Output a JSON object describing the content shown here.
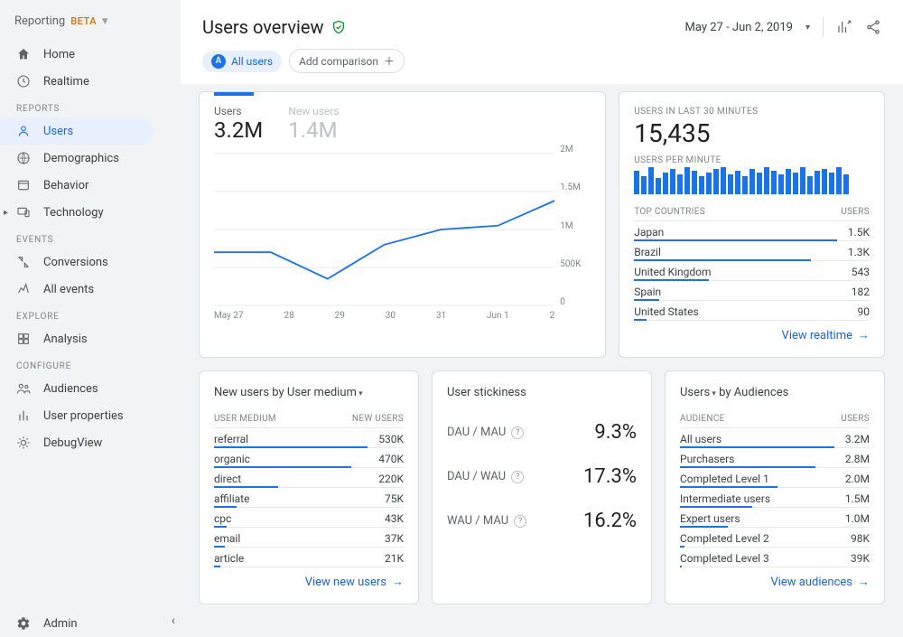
{
  "header": {
    "reporting_label": "Reporting",
    "beta_label": "BETA",
    "title": "Users overview",
    "date_range": "May 27 - Jun 2, 2019",
    "all_users_pill": "All users",
    "all_users_letter": "A",
    "add_comparison": "Add comparison"
  },
  "sidebar": {
    "top": [
      {
        "label": "Home"
      },
      {
        "label": "Realtime"
      }
    ],
    "reports_label": "REPORTS",
    "reports": [
      {
        "label": "Users",
        "active": true
      },
      {
        "label": "Demographics"
      },
      {
        "label": "Behavior"
      },
      {
        "label": "Technology",
        "expandable": true
      }
    ],
    "events_label": "EVENTS",
    "events": [
      {
        "label": "Conversions"
      },
      {
        "label": "All events"
      }
    ],
    "explore_label": "EXPLORE",
    "explore": [
      {
        "label": "Analysis"
      }
    ],
    "configure_label": "CONFIGURE",
    "configure": [
      {
        "label": "Audiences"
      },
      {
        "label": "User properties"
      },
      {
        "label": "DebugView"
      }
    ],
    "admin_label": "Admin"
  },
  "overview": {
    "users_label": "Users",
    "users_value": "3.2M",
    "new_users_label": "New users",
    "new_users_value": "1.4M",
    "yticks": [
      "2M",
      "1.5M",
      "1M",
      "500K",
      "0"
    ],
    "xticks": [
      "May 27",
      "28",
      "29",
      "30",
      "31",
      "Jun 1",
      "2"
    ]
  },
  "chart_data": {
    "type": "line",
    "title": "Users",
    "xlabel": "",
    "ylabel": "",
    "ylim": [
      0,
      2000000
    ],
    "categories": [
      "May 27",
      "28",
      "29",
      "30",
      "31",
      "Jun 1",
      "2"
    ],
    "series": [
      {
        "name": "Users",
        "values": [
          700000,
          700000,
          350000,
          800000,
          1000000,
          1050000,
          1380000
        ]
      }
    ]
  },
  "realtime": {
    "subt30": "USERS IN LAST 30 MINUTES",
    "big": "15,435",
    "upm_label": "USERS PER MINUTE",
    "top_countries_label": "TOP COUNTRIES",
    "users_col": "USERS",
    "rows": [
      {
        "name": "Japan",
        "val": "1.5K",
        "pct": 100
      },
      {
        "name": "Brazil",
        "val": "1.3K",
        "pct": 87
      },
      {
        "name": "United Kingdom",
        "val": "543",
        "pct": 36
      },
      {
        "name": "Spain",
        "val": "182",
        "pct": 12
      },
      {
        "name": "United States",
        "val": "90",
        "pct": 6
      }
    ],
    "link": "View realtime"
  },
  "medium": {
    "title_a": "New users",
    "title_b": "by User medium",
    "col_a": "USER MEDIUM",
    "col_b": "NEW USERS",
    "rows": [
      {
        "name": "referral",
        "val": "530K",
        "pct": 100
      },
      {
        "name": "organic",
        "val": "470K",
        "pct": 89
      },
      {
        "name": "direct",
        "val": "220K",
        "pct": 42
      },
      {
        "name": "affiliate",
        "val": "75K",
        "pct": 14
      },
      {
        "name": "cpc",
        "val": "43K",
        "pct": 8
      },
      {
        "name": "email",
        "val": "37K",
        "pct": 7
      },
      {
        "name": "article",
        "val": "21K",
        "pct": 4
      }
    ],
    "link": "View new users"
  },
  "stickiness": {
    "title": "User stickiness",
    "rows": [
      {
        "label": "DAU / MAU",
        "val": "9.3%"
      },
      {
        "label": "DAU / WAU",
        "val": "17.3%"
      },
      {
        "label": "WAU / MAU",
        "val": "16.2%"
      }
    ]
  },
  "audiences": {
    "title_a": "Users",
    "title_b": "by Audiences",
    "col_a": "AUDIENCE",
    "col_b": "USERS",
    "rows": [
      {
        "name": "All users",
        "val": "3.2M",
        "pct": 100
      },
      {
        "name": "Purchasers",
        "val": "2.8M",
        "pct": 88
      },
      {
        "name": "Completed Level 1",
        "val": "2.0M",
        "pct": 63
      },
      {
        "name": "Intermediate users",
        "val": "1.5M",
        "pct": 47
      },
      {
        "name": "Expert users",
        "val": "1.0M",
        "pct": 31
      },
      {
        "name": "Completed Level 2",
        "val": "98K",
        "pct": 3
      },
      {
        "name": "Completed Level 3",
        "val": "39K",
        "pct": 1
      }
    ],
    "link": "View audiences"
  }
}
